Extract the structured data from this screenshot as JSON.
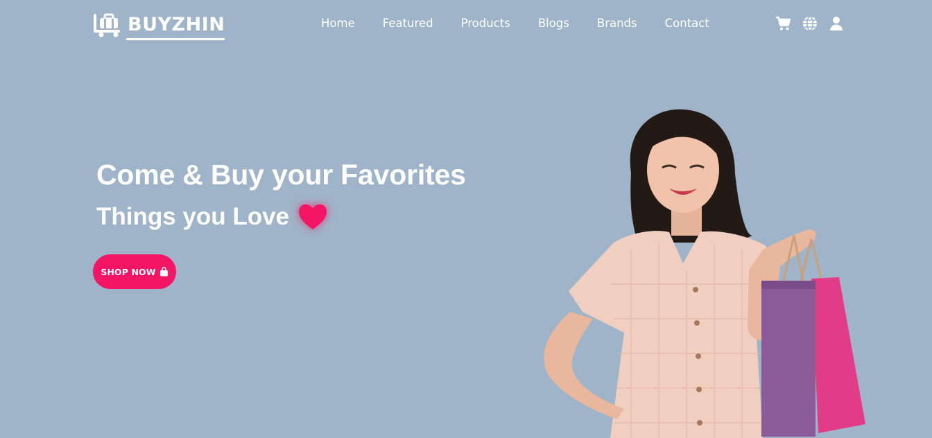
{
  "brand": {
    "name": "BUYZHIN",
    "logo_icon": "luggage-cart-icon"
  },
  "nav": {
    "items": [
      "Home",
      "Featured",
      "Products",
      "Blogs",
      "Brands",
      "Contact"
    ],
    "icons": [
      "cart-icon",
      "globe-icon",
      "user-icon"
    ]
  },
  "hero": {
    "title": "Come & Buy your Favorites",
    "subtitle": "Things you Love",
    "subtitle_icon": "heart-icon",
    "cta_label": "SHOP NOW",
    "cta_icon": "shopping-bag-icon"
  },
  "colors": {
    "background": "#9fb4c8",
    "accent": "#f41664",
    "text": "#ffffff"
  }
}
